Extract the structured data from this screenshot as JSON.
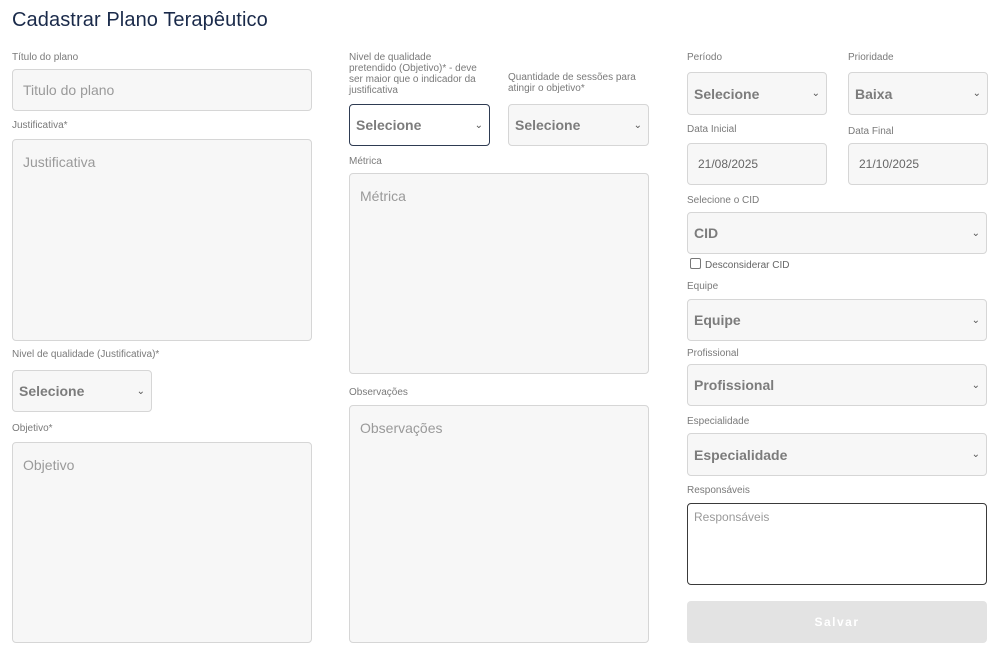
{
  "page": {
    "title": "Cadastrar Plano Terapêutico"
  },
  "col1": {
    "titulo_label": "Título do plano",
    "titulo_placeholder": "Titulo do plano",
    "justificativa_label": "Justificativa*",
    "justificativa_placeholder": "Justificativa",
    "nivel_just_label": "Nivel de qualidade (Justificativa)*",
    "nivel_just_value": "Selecione",
    "objetivo_label": "Objetivo*",
    "objetivo_placeholder": "Objetivo"
  },
  "col2": {
    "nivel_obj_label_1": "Nivel de qualidade",
    "nivel_obj_label_2": "pretendido (Objetivo)* - deve",
    "nivel_obj_label_3": "ser maior que o indicador da",
    "nivel_obj_label_4": "justificativa",
    "nivel_obj_value": "Selecione",
    "sessoes_label_1": "Quantidade de sessões para",
    "sessoes_label_2": "atingir o objetivo*",
    "sessoes_value": "Selecione",
    "metrica_label": "Métrica",
    "metrica_placeholder": "Métrica",
    "observacoes_label": "Observações",
    "observacoes_placeholder": "Observações"
  },
  "col3": {
    "periodo_label": "Período",
    "periodo_value": "Selecione",
    "prioridade_label": "Prioridade",
    "prioridade_value": "Baixa",
    "data_inicial_label": "Data Inicial",
    "data_inicial_value": "21/08/2025",
    "data_final_label": "Data Final",
    "data_final_value": "21/10/2025",
    "cid_label": "Selecione o CID",
    "cid_value": "CID",
    "desconsiderar_label": "Desconsiderar CID",
    "equipe_label": "Equipe",
    "equipe_value": "Equipe",
    "profissional_label": "Profissional",
    "profissional_value": "Profissional",
    "especialidade_label": "Especialidade",
    "especialidade_value": "Especialidade",
    "responsaveis_label": "Responsáveis",
    "responsaveis_placeholder": "Responsáveis",
    "salvar_label": "Salvar"
  },
  "icons": {
    "chevron": "⌄"
  }
}
